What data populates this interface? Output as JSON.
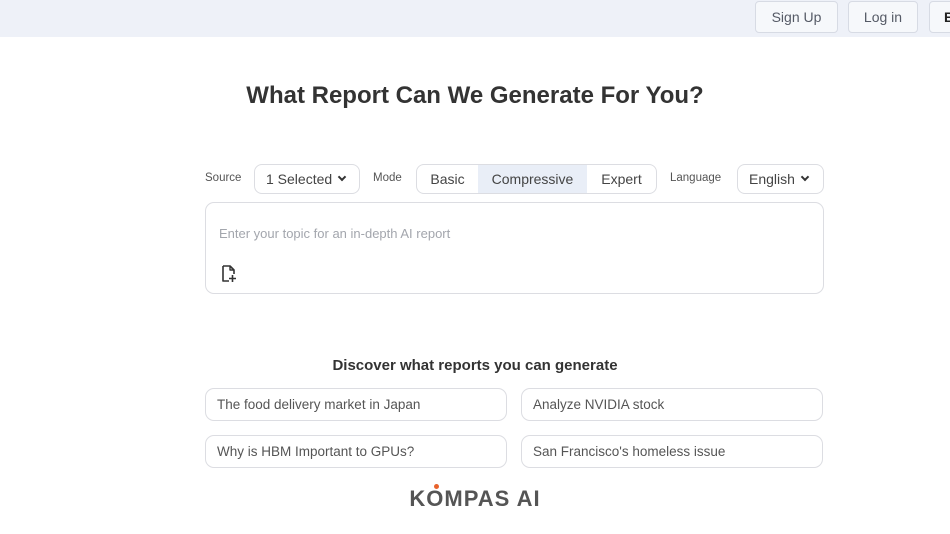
{
  "header": {
    "signup_label": "Sign Up",
    "login_label": "Log in",
    "cut_button_label": "B"
  },
  "headline": "What Report Can We Generate For You?",
  "controls": {
    "source_label": "Source",
    "source_value": "1 Selected",
    "mode_label": "Mode",
    "modes": [
      "Basic",
      "Compressive",
      "Expert"
    ],
    "selected_mode": "Compressive",
    "language_label": "Language",
    "language_value": "English"
  },
  "topic": {
    "placeholder": "Enter your topic for an in-depth AI report",
    "value": "",
    "attach_icon": "file-attach-icon"
  },
  "discover": {
    "title": "Discover what reports you can generate",
    "suggestions": [
      "The food delivery market in Japan",
      "Analyze NVIDIA stock",
      "Why is HBM Important to GPUs?",
      "San Francisco's homeless issue"
    ]
  },
  "logo": {
    "text_before": "K",
    "text_o": "O",
    "text_after": "MPAS AI",
    "accent_color": "#e8622c"
  },
  "colors": {
    "topbar_bg": "#eef1f8",
    "selected_mode_bg": "#e9eef7",
    "border": "#dcdde2"
  }
}
